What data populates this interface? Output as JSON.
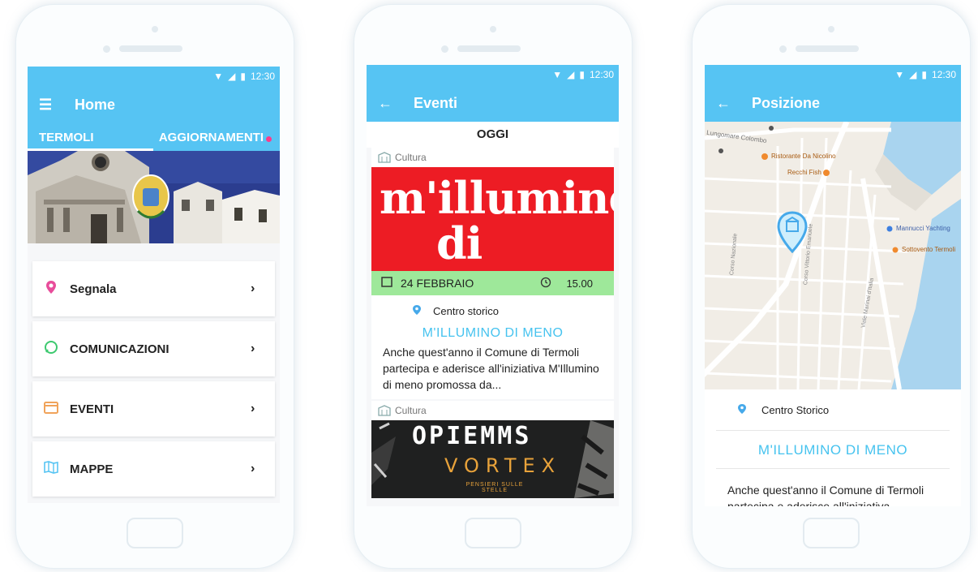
{
  "status": {
    "time": "12:30"
  },
  "screen1": {
    "title": "Home",
    "tabs": [
      {
        "label": "TERMOLI"
      },
      {
        "label": "AGGIORNAMENTI"
      }
    ],
    "menu": [
      {
        "label": "Segnala",
        "icon": "pin-icon",
        "color": "#e84d9b"
      },
      {
        "label": "COMUNICAZIONI",
        "icon": "chat-bubble-icon",
        "color": "#3dc96f"
      },
      {
        "label": "EVENTI",
        "icon": "calendar-icon",
        "color": "#f0a35a"
      },
      {
        "label": "MAPPE",
        "icon": "map-icon",
        "color": "#56c4f3"
      }
    ]
  },
  "screen2": {
    "title": "Eventi",
    "section": "OGGI",
    "events": [
      {
        "category": "Cultura",
        "banner_line1": "m'illumino",
        "banner_line2": "di meno",
        "date": "24 FEBBRAIO",
        "time": "15.00",
        "location": "Centro storico",
        "title": "M'ILLUMINO DI MENO",
        "description": "Anche quest'anno il Comune di Termoli partecipa e aderisce all'iniziativa M'Illumino di meno promossa da..."
      },
      {
        "category": "Cultura",
        "banner_line1": "OPIEMMS",
        "banner_line2": "VORTEX",
        "banner_line3": "PENSIERI SULLE STELLE"
      }
    ]
  },
  "screen3": {
    "title": "Posizione",
    "map_labels": {
      "road_top": "Lungomare Colombo",
      "poi1": "Ristorante Da Nicolino",
      "poi2": "Recchi Fish",
      "poi3": "Mannucci Yachting",
      "poi4": "Sottovento Termoli",
      "street1": "Corso Nazionale",
      "street2": "Corso Vittorio Emanuele",
      "street3": "Viale Marinai d'Italia"
    },
    "location": "Centro Storico",
    "title_event": "M'ILLUMINO DI MENO",
    "description": "Anche quest'anno il Comune di Termoli partecipa e aderisce all'iniziativa"
  },
  "colors": {
    "primary": "#56c4f3",
    "accent": "#ff3b8a",
    "date_bar": "#9ee89a",
    "banner_red": "#ed1c24"
  }
}
